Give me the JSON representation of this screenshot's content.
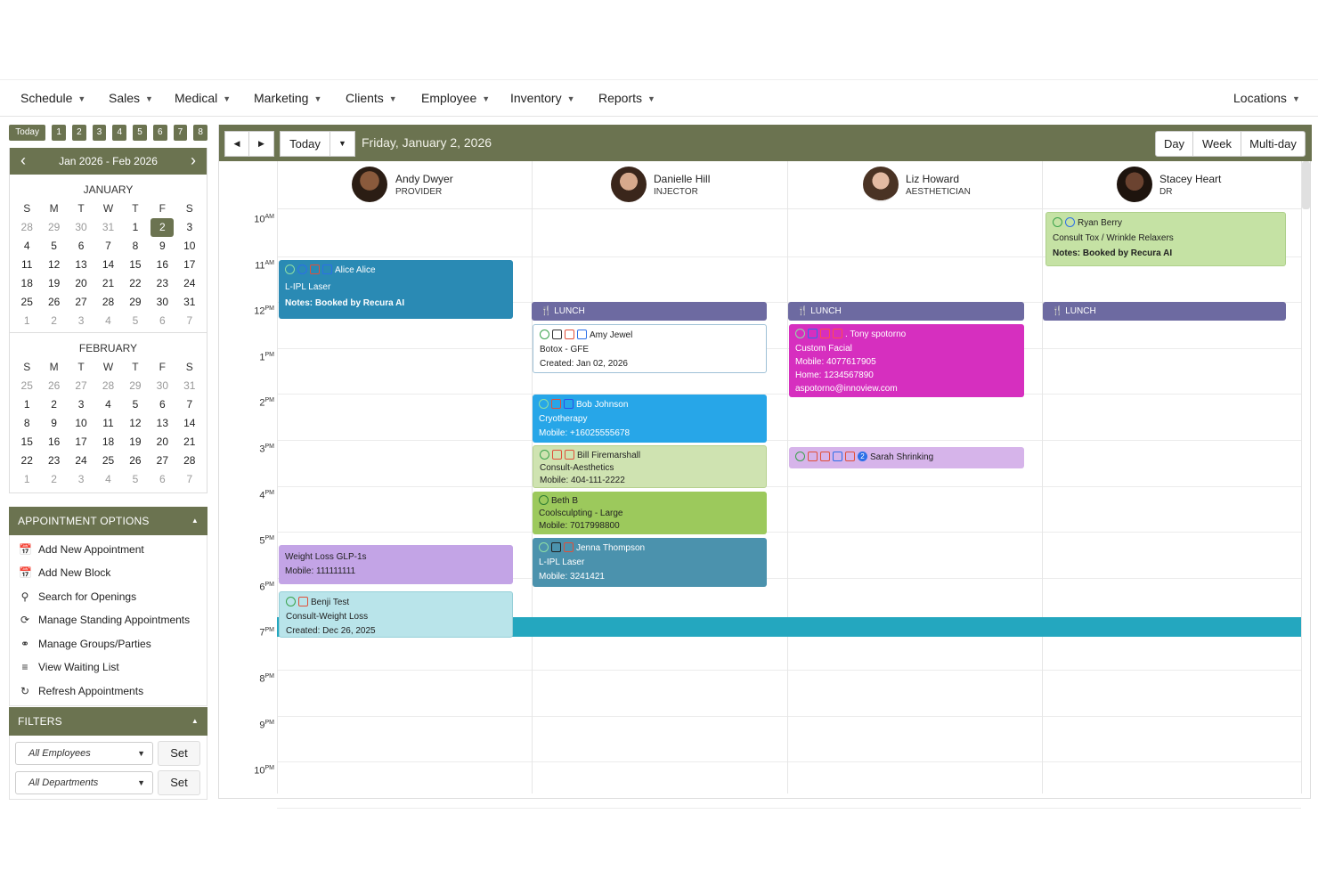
{
  "nav": {
    "items": [
      "Schedule",
      "Sales",
      "Medical",
      "Marketing",
      "Clients",
      "Employee",
      "Inventory",
      "Reports"
    ],
    "locations": "Locations"
  },
  "quick": {
    "today": "Today",
    "weeks": [
      "1",
      "2",
      "3",
      "4",
      "5",
      "6",
      "7",
      "8"
    ]
  },
  "mini_calendar": {
    "range": "Jan 2026 - Feb 2026",
    "weekdays": [
      "S",
      "M",
      "T",
      "W",
      "T",
      "F",
      "S"
    ],
    "months": [
      {
        "name": "JANUARY",
        "days": [
          "28",
          "29",
          "30",
          "31",
          "1",
          "2",
          "3",
          "4",
          "5",
          "6",
          "7",
          "8",
          "9",
          "10",
          "11",
          "12",
          "13",
          "14",
          "15",
          "16",
          "17",
          "18",
          "19",
          "20",
          "21",
          "22",
          "23",
          "24",
          "25",
          "26",
          "27",
          "28",
          "29",
          "30",
          "31",
          "1",
          "2",
          "3",
          "4",
          "5",
          "6",
          "7"
        ],
        "selected": "2"
      },
      {
        "name": "FEBRUARY",
        "days": [
          "25",
          "26",
          "27",
          "28",
          "29",
          "30",
          "31",
          "1",
          "2",
          "3",
          "4",
          "5",
          "6",
          "7",
          "8",
          "9",
          "10",
          "11",
          "12",
          "13",
          "14",
          "15",
          "16",
          "17",
          "18",
          "19",
          "20",
          "21",
          "22",
          "23",
          "24",
          "25",
          "26",
          "27",
          "28",
          "1",
          "2",
          "3",
          "4",
          "5",
          "6",
          "7"
        ]
      }
    ]
  },
  "appointment_options": {
    "title": "APPOINTMENT OPTIONS",
    "items": [
      "Add New Appointment",
      "Add New Block",
      "Search for Openings",
      "Manage Standing Appointments",
      "Manage Groups/Parties",
      "View Waiting List",
      "Refresh Appointments"
    ]
  },
  "filters": {
    "title": "FILTERS",
    "employees": "All Employees",
    "departments": "All Departments",
    "set": "Set"
  },
  "toolbar": {
    "today": "Today",
    "date": "Friday, January 2, 2026",
    "views": [
      "Day",
      "Week",
      "Multi-day"
    ]
  },
  "providers": [
    {
      "name": "Andy Dwyer",
      "role": "PROVIDER"
    },
    {
      "name": "Danielle Hill",
      "role": "INJECTOR"
    },
    {
      "name": "Liz Howard",
      "role": "AESTHETICIAN"
    },
    {
      "name": "Stacey Heart",
      "role": "DR"
    }
  ],
  "time_labels": [
    {
      "h": "10",
      "m": "AM"
    },
    {
      "h": "11",
      "m": "AM"
    },
    {
      "h": "12",
      "m": "PM"
    },
    {
      "h": "1",
      "m": "PM"
    },
    {
      "h": "2",
      "m": "PM"
    },
    {
      "h": "3",
      "m": "PM"
    },
    {
      "h": "4",
      "m": "PM"
    },
    {
      "h": "5",
      "m": "PM"
    },
    {
      "h": "6",
      "m": "PM"
    },
    {
      "h": "7",
      "m": "PM"
    },
    {
      "h": "8",
      "m": "PM"
    },
    {
      "h": "9",
      "m": "PM"
    },
    {
      "h": "10",
      "m": "PM"
    }
  ],
  "lunch_label": "LUNCH",
  "appointments": {
    "alice": {
      "client": "Alice Alice",
      "service": "L-IPL Laser",
      "notes": "Notes: Booked by Recura AI",
      "color": "#2a8ab4"
    },
    "ryan": {
      "client": "Ryan Berry",
      "service": "Consult Tox / Wrinkle Relaxers",
      "notes": "Notes: Booked by Recura AI",
      "color": "#c5e2a4"
    },
    "amy": {
      "client": "Amy Jewel",
      "service": "Botox - GFE",
      "created": "Created: Jan 02, 2026",
      "color": "#ffffff"
    },
    "tony": {
      "client": ". Tony spotorno",
      "service": "Custom Facial",
      "mobile": "Mobile: 4077617905",
      "home": "Home: 1234567890",
      "email": "aspotorno@innoview.com",
      "color": "#d62fbf"
    },
    "bob": {
      "client": "Bob Johnson",
      "service": "Cryotherapy",
      "mobile": "Mobile: +16025555678",
      "color": "#27a6e8"
    },
    "bill": {
      "client": "Bill Firemarshall",
      "service": "Consult-Aesthetics",
      "mobile": "Mobile: 404-111-2222",
      "color": "#cfe3b1"
    },
    "sarah": {
      "client": "Sarah Shrinking",
      "badge": "2",
      "color": "#d6b4ea"
    },
    "beth": {
      "client": "Beth B",
      "service": "Coolsculpting - Large",
      "mobile": "Mobile: 7017998800",
      "color": "#9cc95c"
    },
    "jenna": {
      "client": "Jenna Thompson",
      "service": "L-IPL Laser",
      "mobile": "Mobile: 3241421",
      "color": "#4b92ad"
    },
    "weight": {
      "service": "Weight Loss GLP-1s",
      "mobile": "Mobile: 111111111",
      "color": "#c3a4e6"
    },
    "benji": {
      "client": "Benji Test",
      "service": "Consult-Weight Loss",
      "created": "Created: Dec 26, 2025",
      "color": "#b9e4ea"
    }
  },
  "colors": {
    "brand": "#6b7350",
    "lunch": "#6d6aa1",
    "now": "#24a7bf"
  }
}
